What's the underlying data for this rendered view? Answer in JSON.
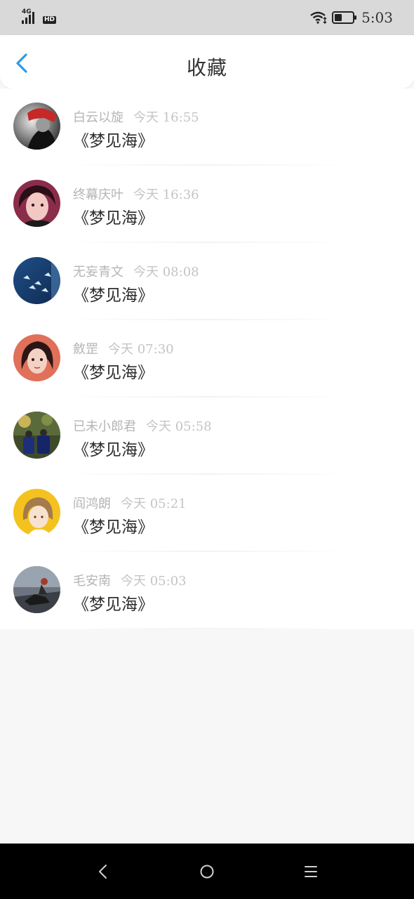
{
  "status": {
    "network": "4G",
    "hd": "HD",
    "time": "5:03"
  },
  "header": {
    "title": "收藏"
  },
  "favorites": [
    {
      "name": "白云以旋",
      "time": "今天 16:55",
      "work": "《梦见海》"
    },
    {
      "name": "终幕庆叶",
      "time": "今天 16:36",
      "work": "《梦见海》"
    },
    {
      "name": "无妄青文",
      "time": "今天 08:08",
      "work": "《梦见海》"
    },
    {
      "name": "斂罡",
      "time": "今天 07:30",
      "work": "《梦见海》"
    },
    {
      "name": "已未小郎君",
      "time": "今天 05:58",
      "work": "《梦见海》"
    },
    {
      "name": "阎鸿朗",
      "time": "今天 05:21",
      "work": "《梦见海》"
    },
    {
      "name": "毛安南",
      "time": "今天 05:03",
      "work": "《梦见海》"
    }
  ],
  "colors": {
    "accent": "#2a9be8",
    "background": "#f8f7f8"
  }
}
